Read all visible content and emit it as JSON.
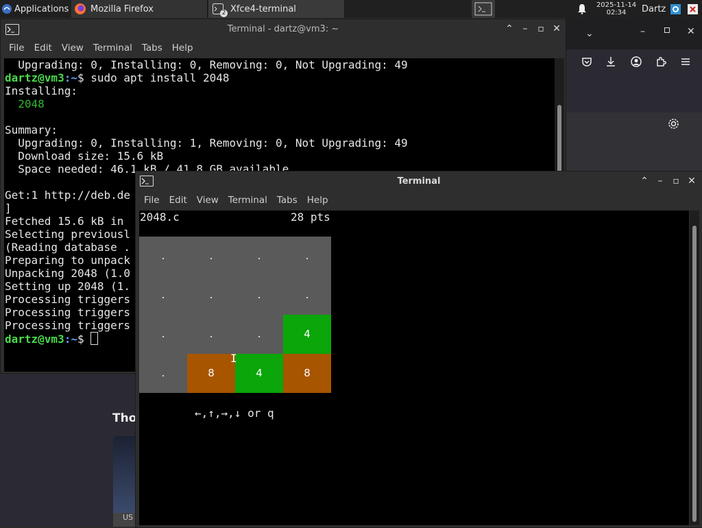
{
  "panel": {
    "applications_label": "Applications",
    "tasks": [
      {
        "label": "Mozilla Firefox"
      },
      {
        "label": "Xfce4-terminal",
        "badge": "2"
      }
    ],
    "date": "2025-11-14",
    "time": "02:34",
    "user": "Dartz"
  },
  "bg_page": {
    "heading_fragment": "Thor",
    "footer_fragment": "US"
  },
  "terminal_back": {
    "title": "Terminal - dartz@vm3: ~",
    "menu": [
      "File",
      "Edit",
      "View",
      "Terminal",
      "Tabs",
      "Help"
    ],
    "lines": [
      {
        "text": "  Upgrading: 0, Installing: 0, Removing: 0, Not Upgrading: 49"
      },
      {
        "user": "dartz@vm3",
        "path": ":~",
        "cmd": "$ sudo apt install 2048"
      },
      {
        "text": "Installing:"
      },
      {
        "text": "  2048",
        "green": true
      },
      {
        "text": ""
      },
      {
        "text": "Summary:"
      },
      {
        "text": "  Upgrading: 0, Installing: 1, Removing: 0, Not Upgrading: 49"
      },
      {
        "text": "  Download size: 15.6 kB"
      },
      {
        "text": "  Space needed: 46.1 kB / 41.8 GB available"
      },
      {
        "text": ""
      },
      {
        "text": "Get:1 http://deb.de"
      },
      {
        "text": "]"
      },
      {
        "text": "Fetched 15.6 kB in "
      },
      {
        "text": "Selecting previousl"
      },
      {
        "text": "(Reading database ."
      },
      {
        "text": "Preparing to unpack"
      },
      {
        "text": "Unpacking 2048 (1.0"
      },
      {
        "text": "Setting up 2048 (1."
      },
      {
        "text": "Processing triggers"
      },
      {
        "text": "Processing triggers"
      },
      {
        "text": "Processing triggers"
      },
      {
        "user": "dartz@vm3",
        "path": ":~",
        "cmd": "$ ",
        "cursor": true
      }
    ]
  },
  "terminal_front": {
    "title": "Terminal",
    "menu": [
      "File",
      "Edit",
      "View",
      "Terminal",
      "Tabs",
      "Help"
    ],
    "game_name": "2048.c",
    "score": "28 pts",
    "board": [
      [
        ".",
        ".",
        ".",
        "."
      ],
      [
        ".",
        ".",
        ".",
        "."
      ],
      [
        ".",
        ".",
        ".",
        "4"
      ],
      [
        ".",
        "8",
        "4",
        "8"
      ]
    ],
    "hint": "←,↑,→,↓ or q",
    "colors": {
      "empty": "#5a5a5a",
      "tile4": "#0aa60a",
      "tile8": "#a85500"
    }
  }
}
